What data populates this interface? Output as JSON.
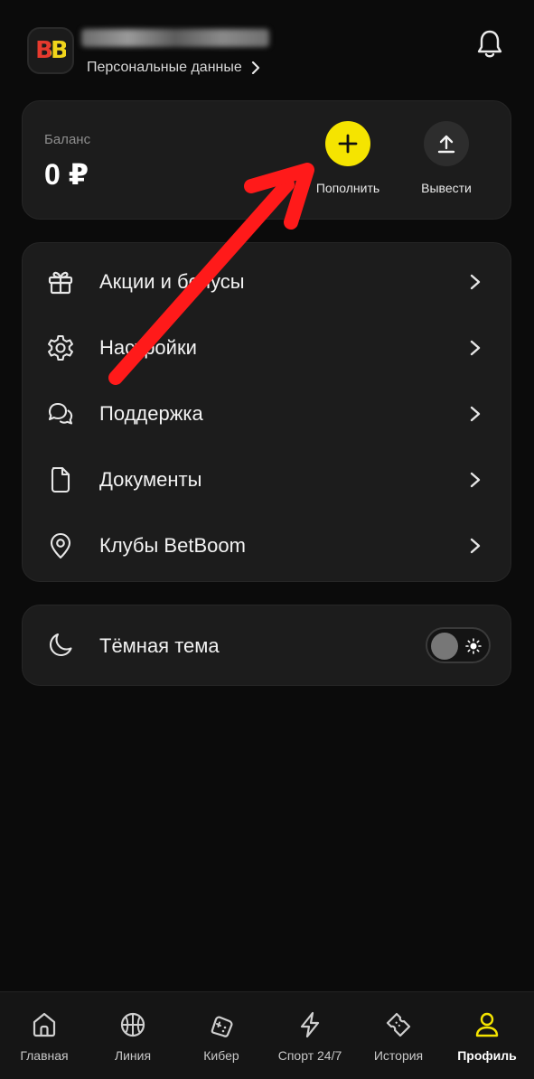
{
  "header": {
    "logo_text": "BB",
    "personal_link": "Персональные данные",
    "icons": {
      "logo": "betboom-logo",
      "bell": "bell-icon",
      "chevron": "chevron-right-icon"
    }
  },
  "balance": {
    "label": "Баланс",
    "value": "0 ₽",
    "topup_label": "Пополнить",
    "withdraw_label": "Вывести",
    "topup_color": "#f5e400"
  },
  "menu": {
    "items": [
      {
        "label": "Акции и бонусы",
        "icon": "gift-icon"
      },
      {
        "label": "Настройки",
        "icon": "gear-icon"
      },
      {
        "label": "Поддержка",
        "icon": "chat-icon"
      },
      {
        "label": "Документы",
        "icon": "document-icon"
      },
      {
        "label": "Клубы BetBoom",
        "icon": "location-pin-icon"
      }
    ]
  },
  "theme": {
    "label": "Тёмная тема",
    "dark_enabled": false
  },
  "nav": {
    "items": [
      {
        "label": "Главная",
        "icon": "home-icon",
        "active": false
      },
      {
        "label": "Линия",
        "icon": "basketball-icon",
        "active": false
      },
      {
        "label": "Кибер",
        "icon": "gamepad-icon",
        "active": false
      },
      {
        "label": "Спорт 24/7",
        "icon": "lightning-icon",
        "active": false
      },
      {
        "label": "История",
        "icon": "ticket-icon",
        "active": false
      },
      {
        "label": "Профиль",
        "icon": "user-icon",
        "active": true
      }
    ],
    "active_color": "#f5e400"
  },
  "annotation": {
    "arrow_color": "#ff1a1a"
  }
}
